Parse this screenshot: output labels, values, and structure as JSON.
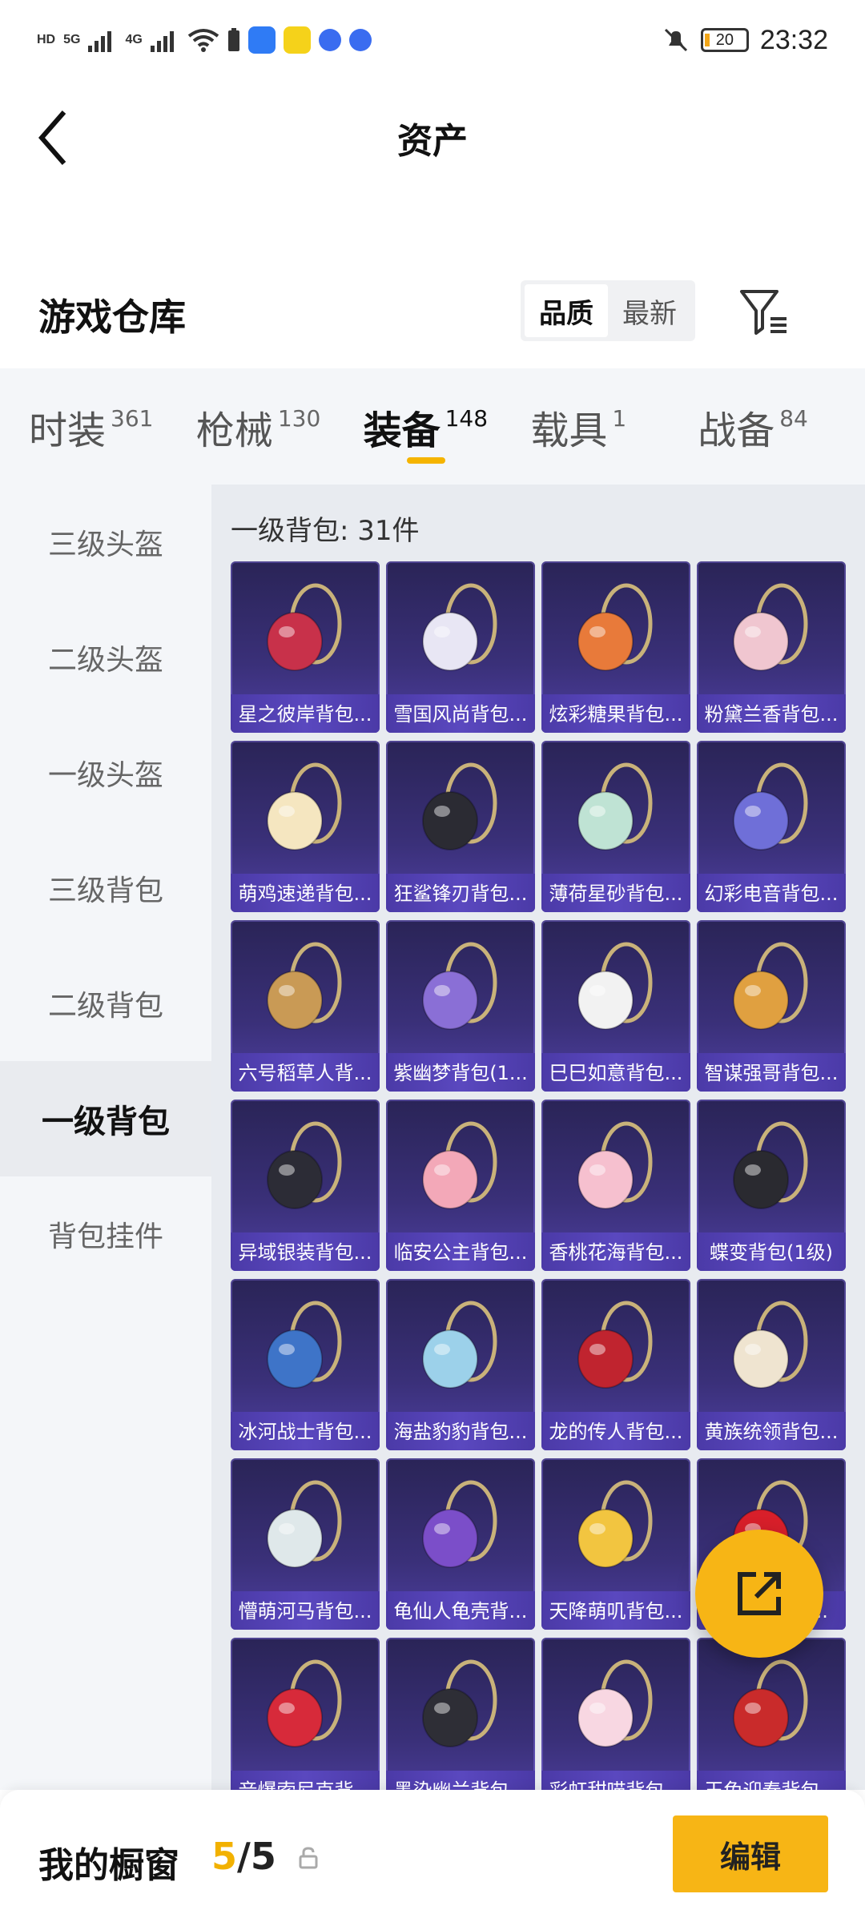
{
  "status_bar": {
    "time": "23:32",
    "battery": "20",
    "network": [
      "HD",
      "5G",
      "4G"
    ]
  },
  "header": {
    "title": "资产",
    "back_icon": "chevron-left-icon"
  },
  "warehouse": {
    "title": "游戏仓库",
    "sort_options": [
      "品质",
      "最新"
    ],
    "sort_selected": "品质",
    "filter_icon": "filter-icon"
  },
  "tabs": [
    {
      "label": "时装",
      "count": "361"
    },
    {
      "label": "枪械",
      "count": "130"
    },
    {
      "label": "装备",
      "count": "148",
      "active": true
    },
    {
      "label": "载具",
      "count": "1"
    },
    {
      "label": "战备",
      "count": "84"
    }
  ],
  "sidebar": {
    "items": [
      "三级头盔",
      "二级头盔",
      "一级头盔",
      "三级背包",
      "二级背包",
      "一级背包",
      "背包挂件"
    ],
    "active": "一级背包"
  },
  "content": {
    "section_title": "一级背包: 31件",
    "items": [
      "星之彼岸背包...",
      "雪国风尚背包...",
      "炫彩糖果背包...",
      "粉黛兰香背包...",
      "萌鸡速递背包...",
      "狂鲨锋刃背包...",
      "薄荷星砂背包...",
      "幻彩电音背包...",
      "六号稻草人背...",
      "紫幽梦背包(1...",
      "巳巳如意背包...",
      "智谋强哥背包...",
      "异域银装背包...",
      "临安公主背包...",
      "香桃花海背包...",
      "蝶变背包(1级)",
      "冰河战士背包...",
      "海盐豹豹背包...",
      "龙的传人背包...",
      "黄族统领背包...",
      "懵萌河马背包...",
      "龟仙人龟壳背...",
      "天降萌叽背包...",
      "妙红...背包...",
      "音爆索尼克背...",
      "墨染幽兰背包...",
      "彩虹甜喵背包...",
      "玉兔迎春背包..."
    ]
  },
  "fab": {
    "icon": "share-external-icon"
  },
  "bottom": {
    "title": "我的橱窗",
    "count_current": "5",
    "count_sep": "/",
    "count_total": "5",
    "edit_label": "编辑"
  },
  "colors": {
    "accent": "#f7b515",
    "card_top": "#2a2457",
    "card_bottom": "#4e3fa0"
  }
}
